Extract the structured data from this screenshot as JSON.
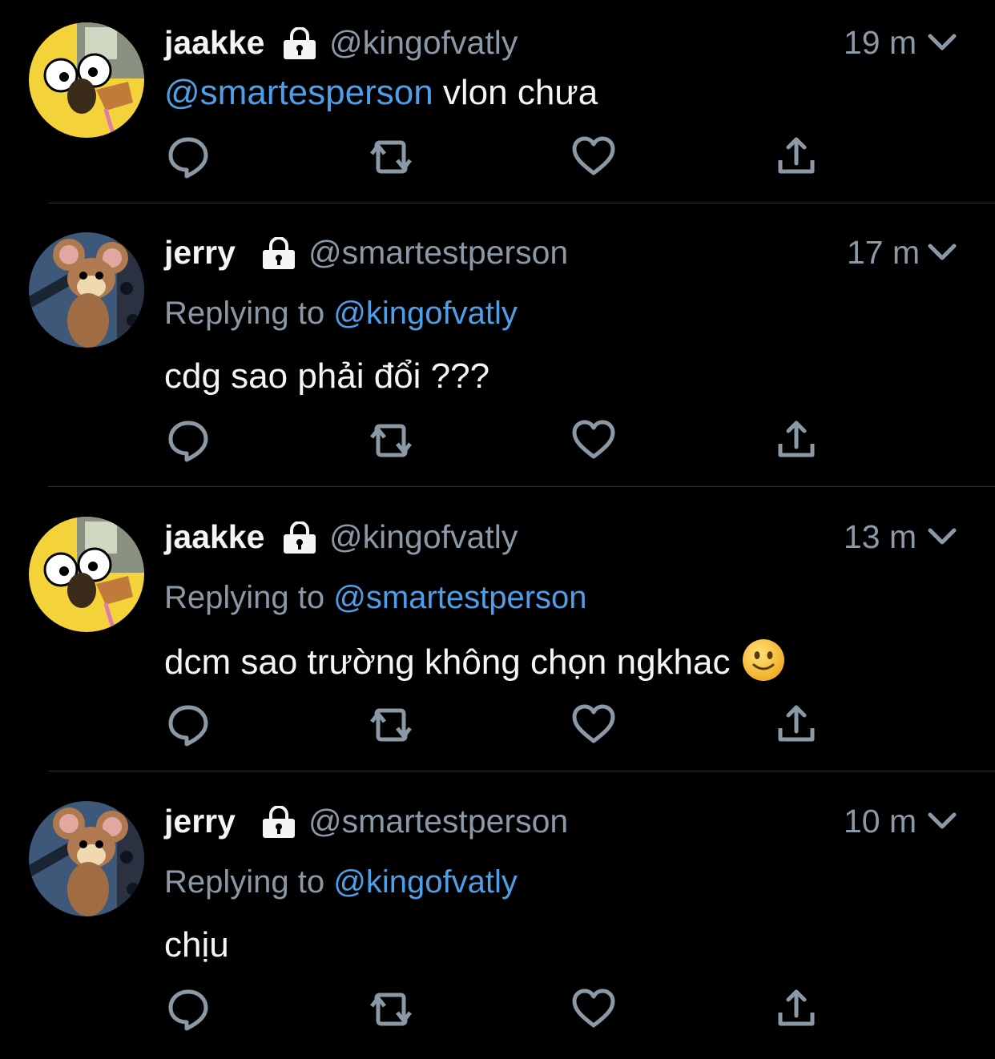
{
  "tweets": [
    {
      "name": "jaakke",
      "handle": "@kingofvatly",
      "time": "19 m",
      "avatar": "jake-avatar",
      "reply_prefix": "",
      "reply_to": "",
      "mention": "@smartesperson",
      "text": " vlon chưa"
    },
    {
      "name": "jerry",
      "handle": "@smartestperson",
      "time": "17 m",
      "avatar": "jerry-avatar",
      "reply_prefix": "Replying to ",
      "reply_to": "@kingofvatly",
      "mention": "",
      "text": "cdg sao phải đổi ???"
    },
    {
      "name": "jaakke",
      "handle": "@kingofvatly",
      "time": "13 m",
      "avatar": "jake-avatar",
      "reply_prefix": "Replying to ",
      "reply_to": "@smartestperson",
      "mention": "",
      "text": "dcm sao trường không chọn ngkhac"
    },
    {
      "name": "jerry",
      "handle": "@smartestperson",
      "time": "10 m",
      "avatar": "jerry-avatar",
      "reply_prefix": "Replying to ",
      "reply_to": "@kingofvatly",
      "mention": "",
      "text": "chịu"
    }
  ],
  "icons": {
    "reply": "reply-icon",
    "retweet": "retweet-icon",
    "like": "like-icon",
    "share": "share-icon",
    "lock": "lock-icon",
    "chevron": "chevron-down-icon",
    "emoji": "slightly-smiling-face-icon"
  },
  "colors": {
    "background": "#000000",
    "mention": "#4e9ee8",
    "secondary_text": "#8b98a5",
    "divider": "#2f3336"
  }
}
